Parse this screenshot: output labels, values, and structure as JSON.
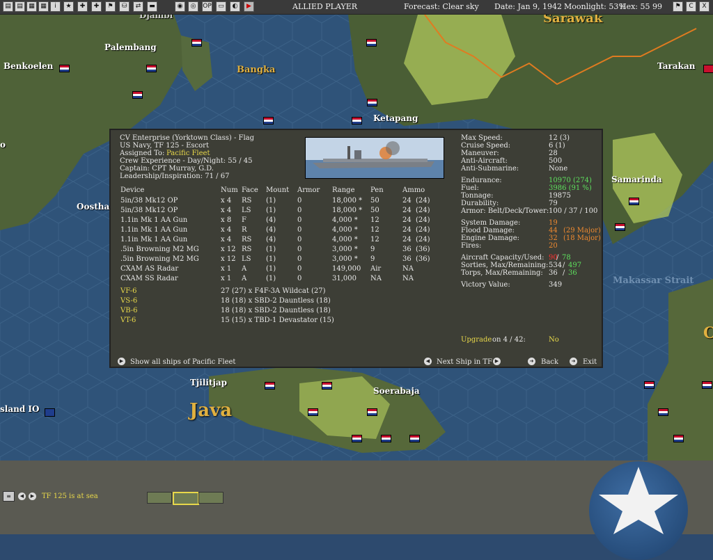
{
  "topbar": {
    "side": "ALLIED PLAYER",
    "forecast": "Forecast: Clear sky",
    "date": "Date: Jan 9, 1942",
    "moonlight": "Moonlight: 53%",
    "hex": "Hex: 55 99",
    "buttons": [
      "▤",
      "▤",
      "▦",
      "▦",
      "i",
      "★",
      "✚",
      "✚",
      "⚑",
      "⛁",
      "⇄",
      "▬",
      "◉",
      "◎",
      "OP",
      "▭",
      "◐",
      "▶"
    ],
    "right_buttons": [
      "⚑",
      "C",
      "X"
    ]
  },
  "map": {
    "labels": {
      "palembang": "Palembang",
      "benkoelen": "Benkoelen",
      "bangka": "Bangka",
      "sarawak": "Sarawak",
      "tarakan": "Tarakan",
      "ketapang": "Ketapang",
      "samarinda": "Samarinda",
      "oosthaven": "Oosthav",
      "makassar": "Makassar Strait",
      "tjilitjap": "Tjilitjap",
      "soerabaja": "Soerabaja",
      "java": "Java",
      "island": "sland IO",
      "djambi": "Djambi",
      "o_left": "o",
      "c_right": "C"
    }
  },
  "panel": {
    "header": {
      "line1": "CV Enterprise (Yorktown Class) - Flag",
      "line2": "US Navy, TF 125 - Escort",
      "assigned_label": "Assigned To:",
      "assigned_value": "Pacific Fleet",
      "crew": "Crew Experience - Day/Night: 55 / 45",
      "captain": "Captain: CPT Murray, G.D.",
      "leadership": "Leadership/Inspiration: 71 / 67"
    },
    "columns": [
      "Device",
      "Num",
      "Face",
      "Mount",
      "Armor",
      "Range",
      "Pen",
      "Ammo"
    ],
    "devices": [
      [
        "5in/38 Mk12 OP",
        "x 4",
        "RS",
        "(1)",
        "0",
        "18,000 *",
        "50",
        "24",
        "(24)"
      ],
      [
        "5in/38 Mk12 OP",
        "x 4",
        "LS",
        "(1)",
        "0",
        "18,000 *",
        "50",
        "24",
        "(24)"
      ],
      [
        "1.1in Mk 1 AA Gun",
        "x 8",
        "F",
        "(4)",
        "0",
        "4,000 *",
        "12",
        "24",
        "(24)"
      ],
      [
        "1.1in Mk 1 AA Gun",
        "x 4",
        "R",
        "(4)",
        "0",
        "4,000 *",
        "12",
        "24",
        "(24)"
      ],
      [
        "1.1in Mk 1 AA Gun",
        "x 4",
        "RS",
        "(4)",
        "0",
        "4,000 *",
        "12",
        "24",
        "(24)"
      ],
      [
        ".5in Browning M2 MG",
        "x 12",
        "RS",
        "(1)",
        "0",
        "3,000 *",
        "9",
        "36",
        "(36)"
      ],
      [
        ".5in Browning M2 MG",
        "x 12",
        "LS",
        "(1)",
        "0",
        "3,000 *",
        "9",
        "36",
        "(36)"
      ],
      [
        "CXAM AS Radar",
        "x 1",
        "A",
        "(1)",
        "0",
        "149,000",
        "Air",
        "NA",
        ""
      ],
      [
        "CXAM SS Radar",
        "x 1",
        "A",
        "(1)",
        "0",
        "31,000",
        "NA",
        "NA",
        ""
      ]
    ],
    "air_groups": [
      [
        "VF-6",
        "27 (27) x F4F-3A Wildcat (27)"
      ],
      [
        "VS-6",
        "18 (18) x SBD-2 Dauntless (18)"
      ],
      [
        "VB-6",
        "18 (18) x SBD-2 Dauntless (18)"
      ],
      [
        "VT-6",
        "15 (15) x TBD-1 Devastator (15)"
      ]
    ],
    "stats": {
      "max_speed": [
        "Max Speed:",
        "12 (3)"
      ],
      "cruise_speed": [
        "Cruise Speed:",
        "6 (1)"
      ],
      "maneuver": [
        "Maneuver:",
        "28"
      ],
      "anti_aircraft": [
        "Anti-Aircraft:",
        "500"
      ],
      "anti_sub": [
        "Anti-Submarine:",
        "None"
      ],
      "endurance": [
        "Endurance:",
        "10970 (274)"
      ],
      "fuel": [
        "Fuel:",
        "3986 (91 %)"
      ],
      "tonnage": [
        "Tonnage:",
        "19875"
      ],
      "durability": [
        "Durability:",
        "79"
      ],
      "armor": [
        "Armor: Belt/Deck/Tower:",
        "100 / 37 / 100"
      ],
      "system_damage": [
        "System Damage:",
        "19"
      ],
      "flood_damage": [
        "Flood Damage:",
        "44",
        "(29 Major)"
      ],
      "engine_damage": [
        "Engine Damage:",
        "32",
        "(18 Major)"
      ],
      "fires": [
        "Fires:",
        "20"
      ],
      "aircraft_capacity": [
        "Aircraft Capacity/Used:",
        "90",
        "78"
      ],
      "sorties": [
        "Sorties, Max/Remaining:",
        "534",
        "497"
      ],
      "torps": [
        "Torps, Max/Remaining:",
        "36",
        "36"
      ],
      "victory": [
        "Victory Value:",
        "349"
      ]
    },
    "upgrade": {
      "label": "Upgrade",
      "on": "on 4 / 42:",
      "value": "No"
    },
    "footer": {
      "show_all": "Show all ships of Pacific Fleet",
      "next_ship": "Next Ship in TF",
      "back": "Back",
      "exit": "Exit"
    }
  },
  "bottom": {
    "status": "TF 125 is at sea"
  },
  "colors": {
    "panel_bg": "#3d3e36",
    "yellow": "#e8d84a",
    "green": "#5ee05e",
    "orange": "#f08a30",
    "red": "#ff3030"
  }
}
